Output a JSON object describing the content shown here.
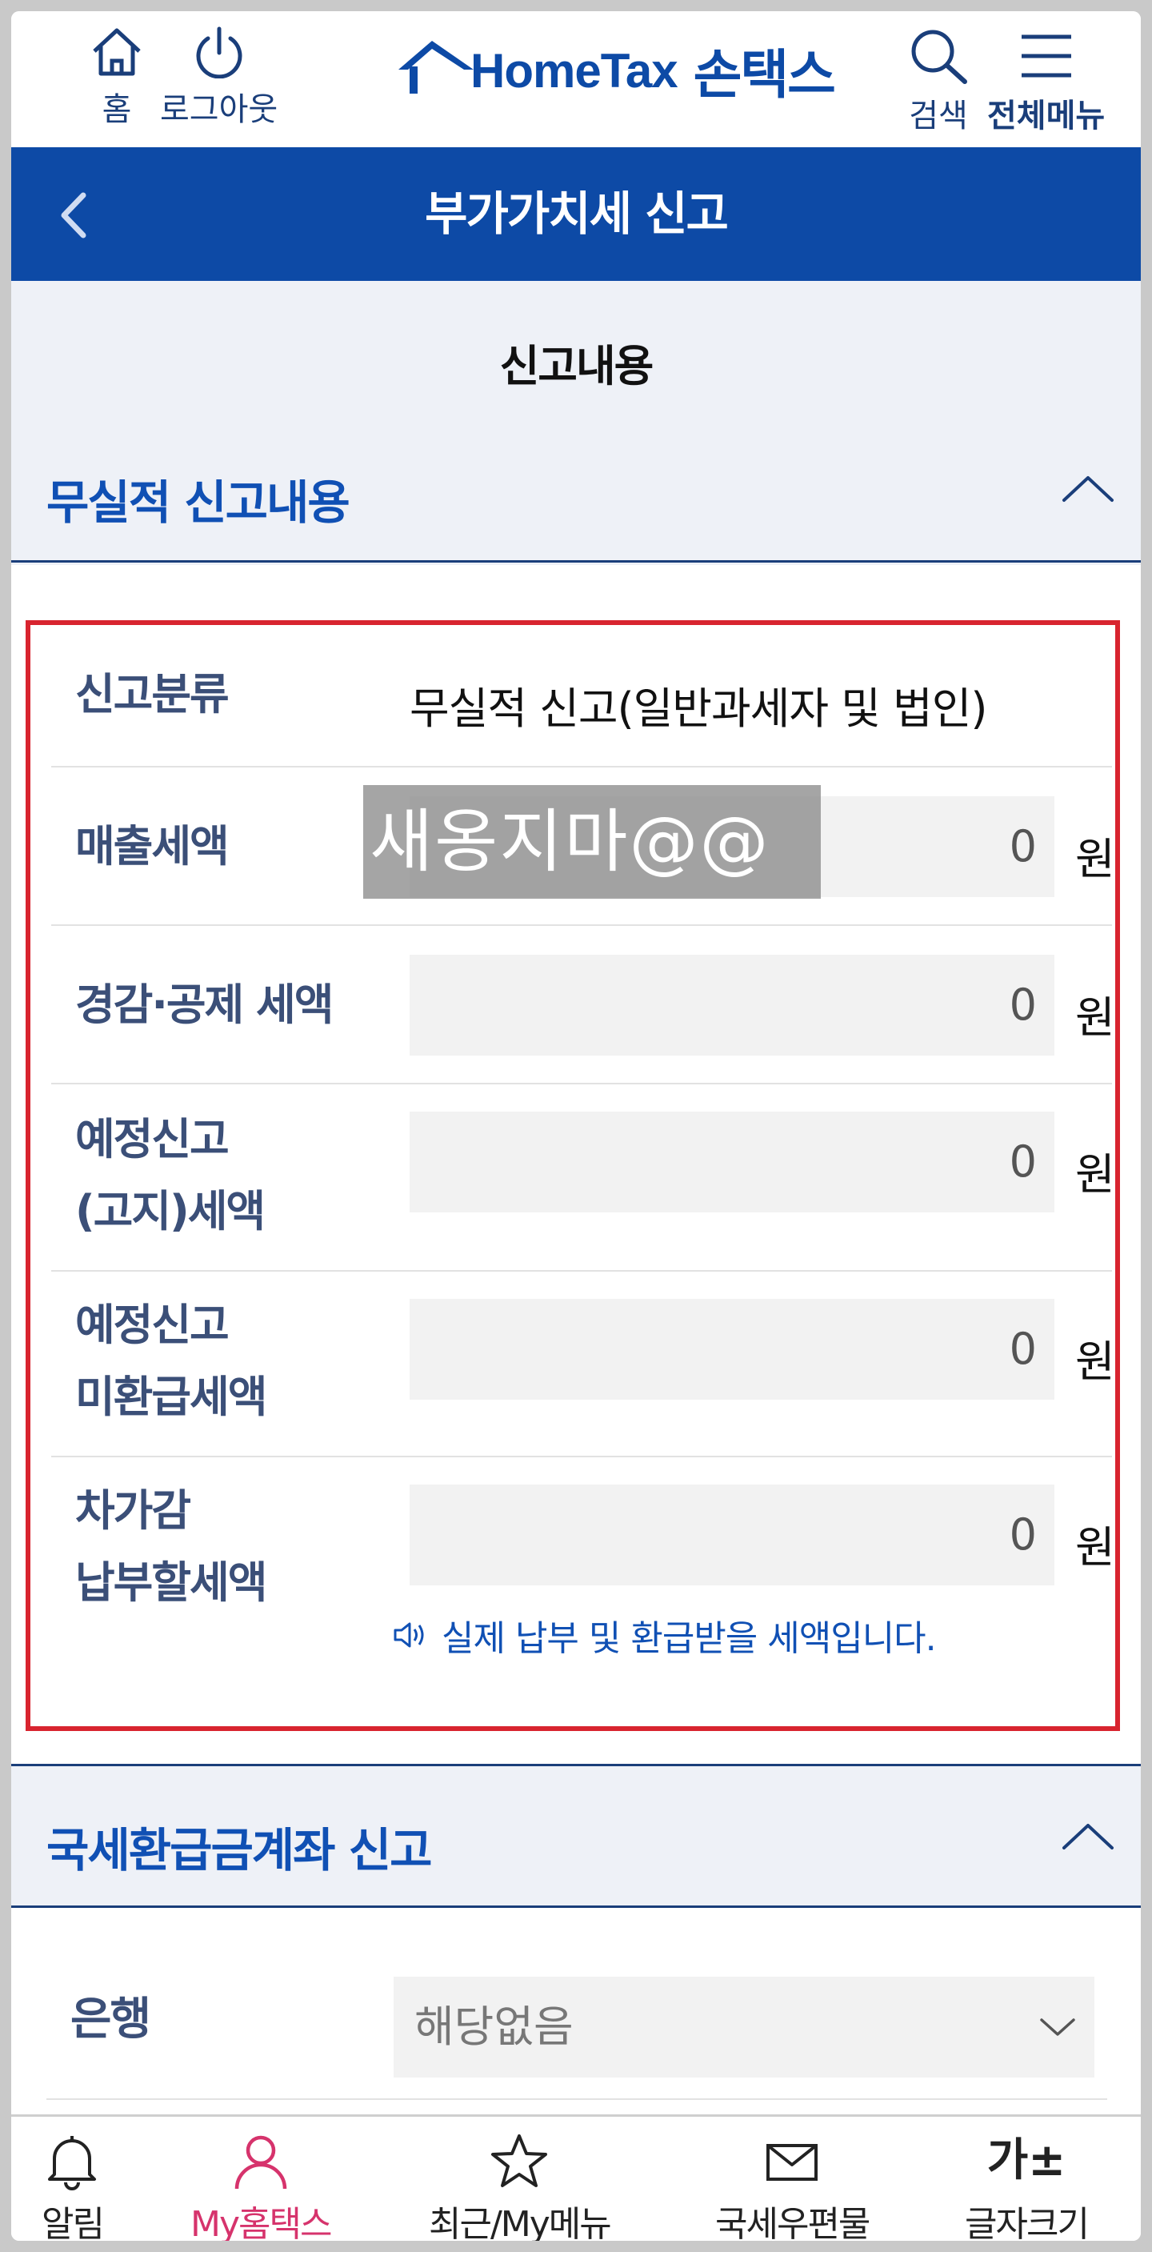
{
  "topbar": {
    "home_label": "홈",
    "logout_label": "로그아웃",
    "logo_en": "HomeTax",
    "logo_ko": "손택스",
    "search_label": "검색",
    "menu_label": "전체메뉴"
  },
  "titlebar": {
    "title": "부가가치세 신고"
  },
  "subheader": {
    "title": "신고내용"
  },
  "section_nil": {
    "title": "무실적 신고내용",
    "rows": {
      "classification_label": "신고분류",
      "classification_value": "무실적 신고(일반과세자 및 법인)",
      "sales_tax_label": "매출세액",
      "sales_tax_value": "0",
      "deduction_label": "경감·공제 세액",
      "deduction_value": "0",
      "prelim_notified_label_1": "예정신고",
      "prelim_notified_label_2": "(고지)세액",
      "prelim_notified_value": "0",
      "prelim_unrefunded_label_1": "예정신고",
      "prelim_unrefunded_label_2": "미환급세액",
      "prelim_unrefunded_value": "0",
      "payable_label_1": "차가감",
      "payable_label_2": "납부할세액",
      "payable_value": "0",
      "unit": "원"
    },
    "watermark": "새옹지마@@",
    "note": "실제 납부 및 환급받을 세액입니다."
  },
  "section_refund": {
    "title": "국세환급금계좌 신고",
    "bank_label": "은행",
    "bank_value": "해당없음"
  },
  "bottomnav": {
    "alarm_label": "알림",
    "my_label": "My홈택스",
    "recent_label": "최근/My메뉴",
    "mail_label": "국세우편물",
    "fontsize_glyph": "가±",
    "fontsize_label": "글자크기"
  },
  "colors": {
    "brand_blue": "#0d4aa6",
    "section_blue": "#1050b4",
    "highlight_red": "#d8242f",
    "active_pink": "#d6336c"
  }
}
